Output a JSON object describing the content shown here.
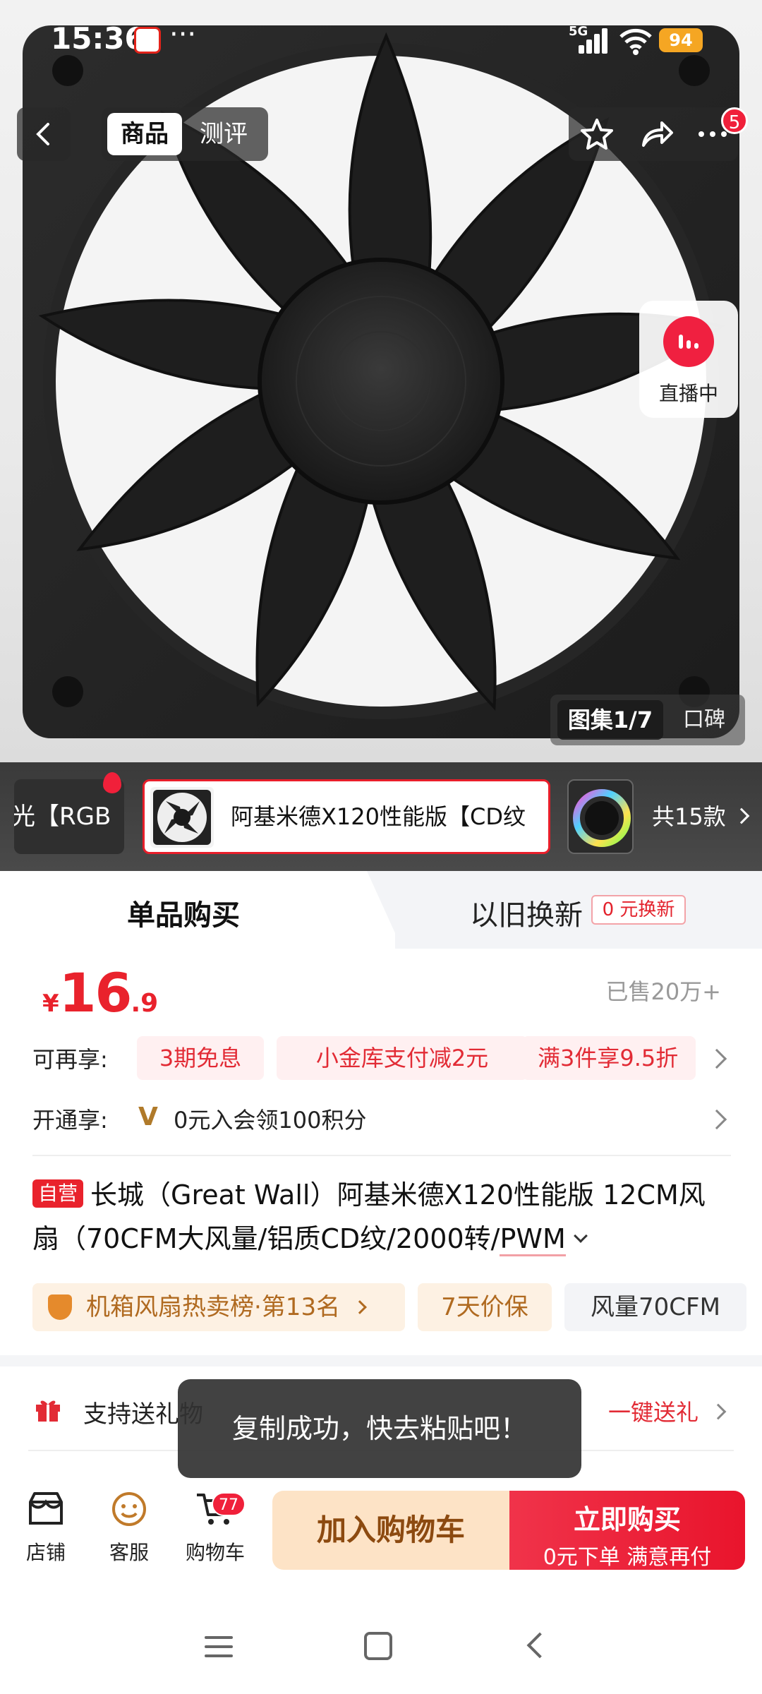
{
  "status_bar": {
    "time": "15:36",
    "network": "5G",
    "battery": "94"
  },
  "top_nav": {
    "tabs": [
      {
        "label": "商品",
        "active": true
      },
      {
        "label": "测评",
        "active": false
      }
    ],
    "more_badge": "5"
  },
  "live": {
    "label": "直播中"
  },
  "gallery": {
    "active_label": "图集1/7",
    "other_label": "口碑"
  },
  "variants": {
    "left_label": "光【RGB",
    "selected_label": "阿基米德X120性能版【CD纹",
    "count_label": "共15款"
  },
  "buy_tabs": {
    "single_label": "单品购买",
    "trade_label": "以旧换新",
    "trade_badge": "0 元换新"
  },
  "price": {
    "currency": "¥",
    "integer": "16",
    "decimal": ".9",
    "sold": "已售20万+"
  },
  "promo": {
    "label": "可再享:",
    "tags": [
      "3期免息",
      "小金库支付减2元",
      "满3件享9.5折"
    ]
  },
  "member": {
    "label": "开通享:",
    "icon": "V",
    "text": "0元入会领100积分"
  },
  "product": {
    "self_badge": "自营",
    "title_main": "长城（Great Wall）阿基米德X120性能版 12CM风扇（70CFM大风量/铝质CD纹/2000转/",
    "title_tail": "PWM"
  },
  "chips": {
    "rank": "机箱风扇热卖榜·第13名",
    "guarantee": "7天价保",
    "airflow": "风量70CFM"
  },
  "gift": {
    "label": "支持送礼物",
    "link": "一键送礼"
  },
  "toast": {
    "text": "复制成功，快去粘贴吧！"
  },
  "bottom_bar": {
    "shop": "店铺",
    "service": "客服",
    "cart": "购物车",
    "cart_badge": "77",
    "add_cart": "加入购物车",
    "buy_now": "立即购买",
    "buy_now_sub": "0元下单 满意再付"
  },
  "colors": {
    "accent": "#e9222c",
    "gold": "#b06a20"
  }
}
